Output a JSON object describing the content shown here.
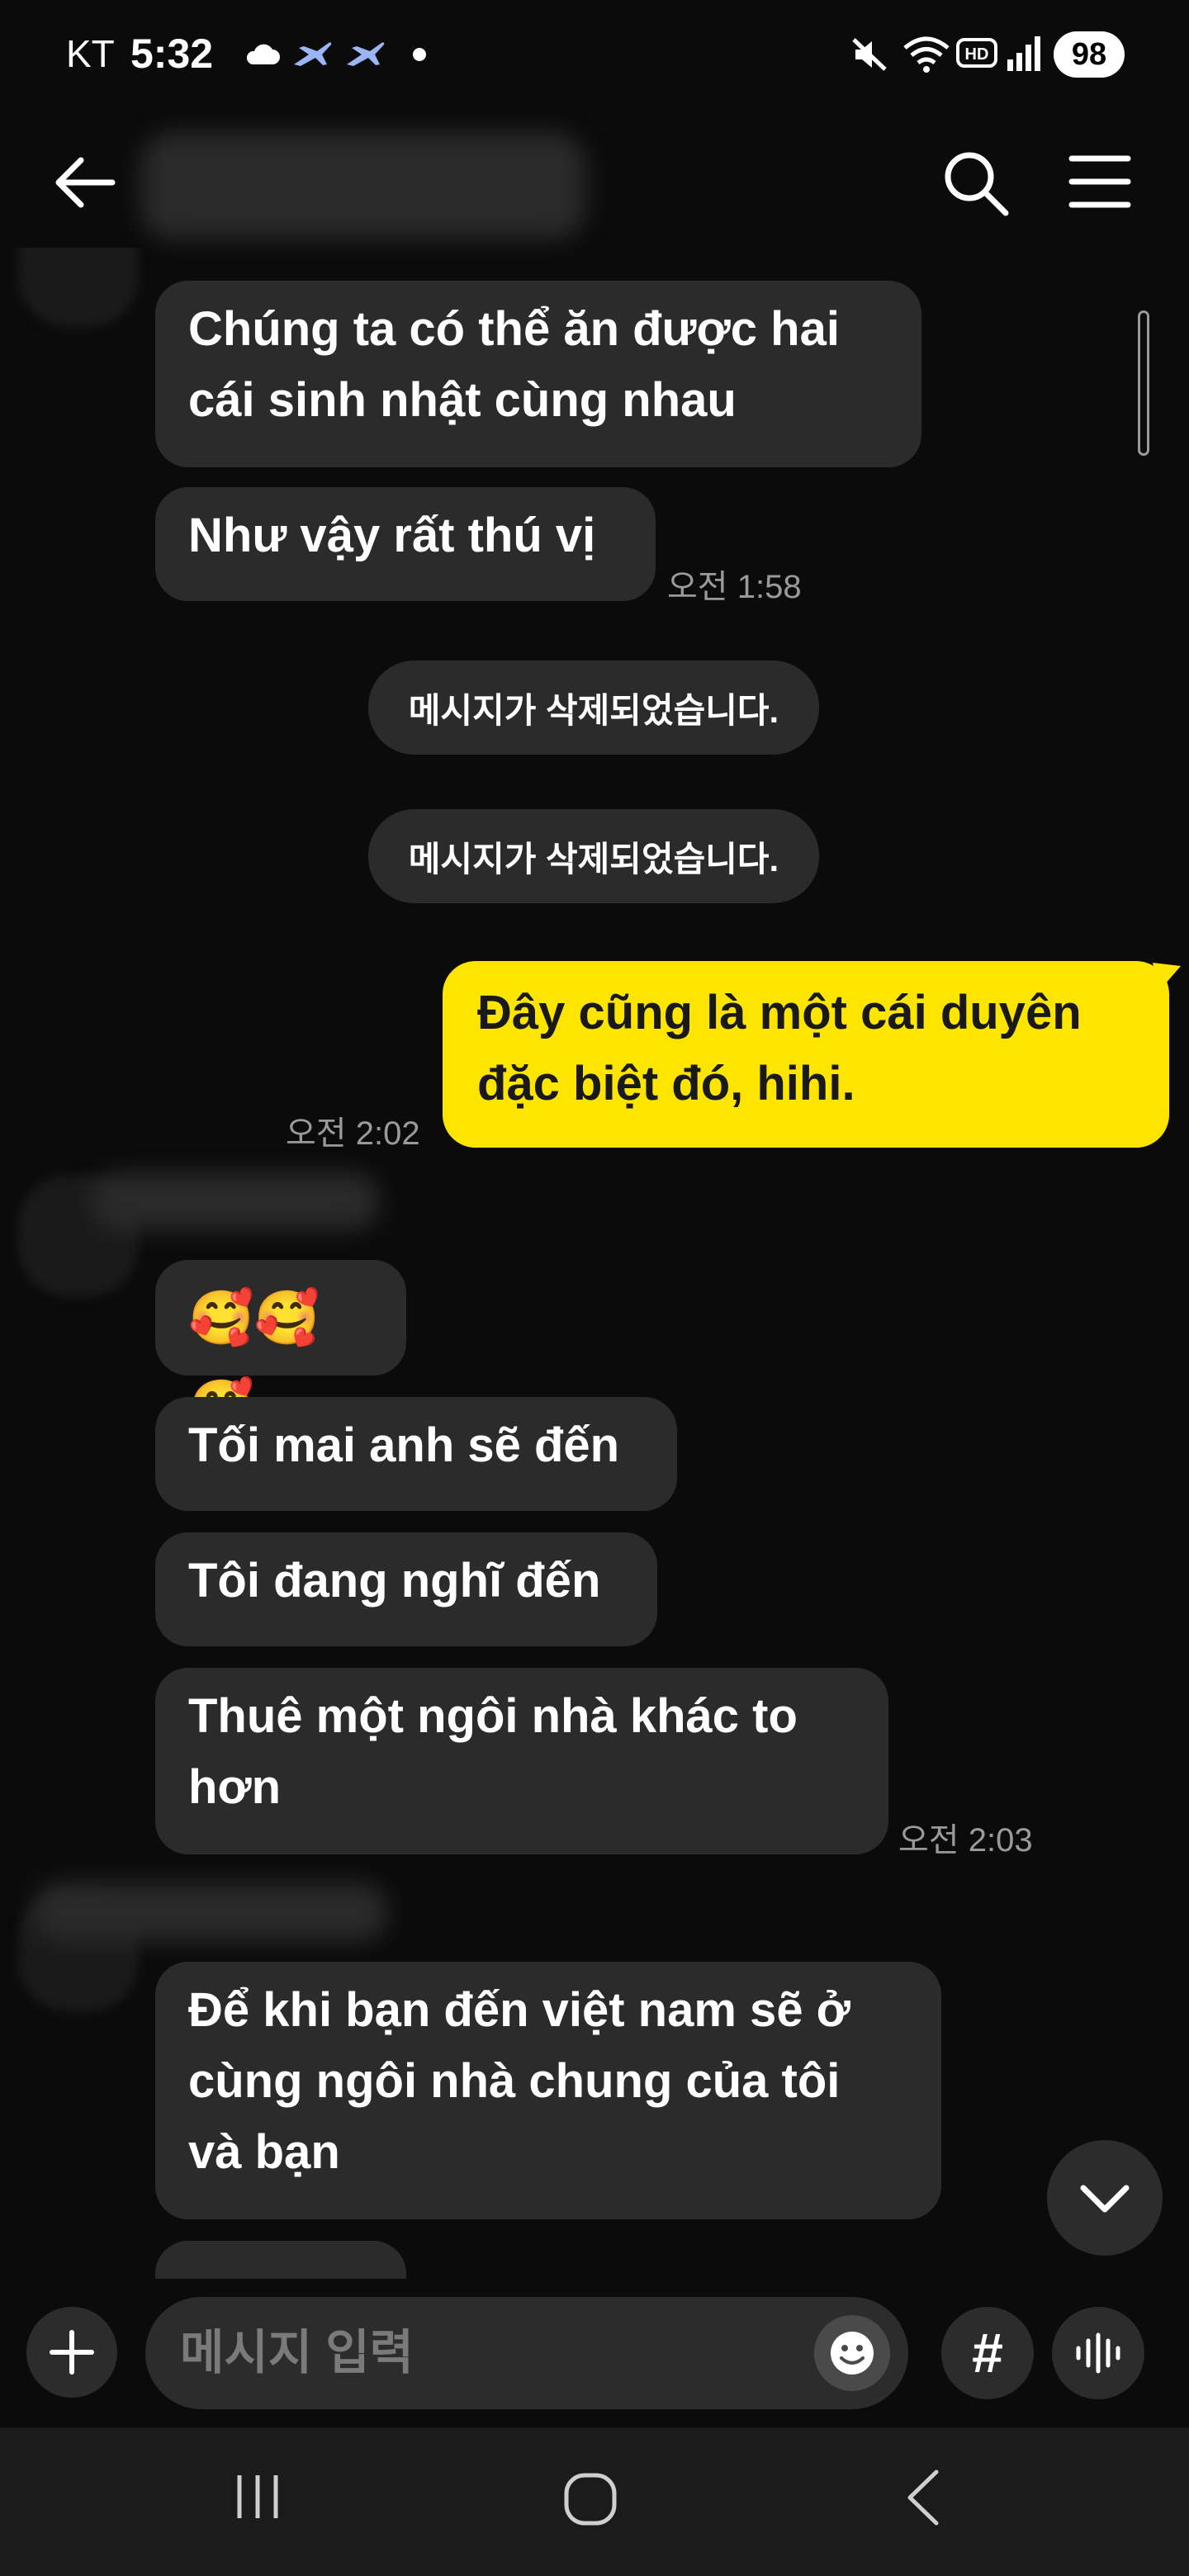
{
  "status_bar": {
    "carrier": "KT",
    "time": "5:32",
    "battery": "98"
  },
  "header": {
    "back_icon": "arrow-left-icon",
    "search_icon": "search-icon",
    "menu_icon": "hamburger-menu-icon"
  },
  "messages": [
    {
      "type": "incoming",
      "text": "Chúng ta có thể ăn được hai\ncái sinh nhật cùng nhau"
    },
    {
      "type": "incoming",
      "text": "Như vậy rất thú vị",
      "time": "오전 1:58"
    },
    {
      "type": "deleted",
      "text": "메시지가 삭제되었습니다."
    },
    {
      "type": "deleted",
      "text": "메시지가 삭제되었습니다."
    },
    {
      "type": "outgoing",
      "text": "Đây cũng là một cái duyên\nđặc biệt đó, hihi.",
      "time": "오전 2:02"
    },
    {
      "type": "incoming",
      "text": "🥰🥰🥰"
    },
    {
      "type": "incoming",
      "text": "Tối mai anh sẽ đến"
    },
    {
      "type": "incoming",
      "text": "Tôi đang nghĩ đến"
    },
    {
      "type": "incoming",
      "text": "Thuê một ngôi nhà khác to\nhơn",
      "time": "오전 2:03"
    },
    {
      "type": "incoming",
      "text": "Để khi bạn đến việt nam sẽ ở\ncùng ngôi nhà chung của tôi\nvà bạn"
    }
  ],
  "input": {
    "placeholder": "메시지 입력",
    "hash_label": "#"
  },
  "colors": {
    "background": "#0b0b0b",
    "incoming_bubble": "#2b2b2b",
    "outgoing_bubble": "#fee500",
    "timestamp": "#9a9a9a"
  }
}
